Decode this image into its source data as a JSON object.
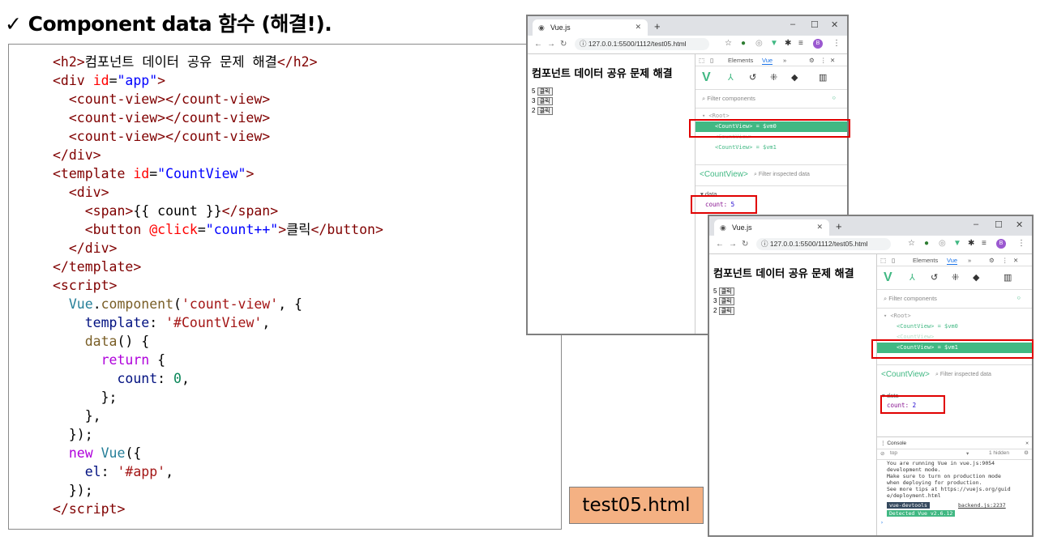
{
  "slide": {
    "title": "✓ Component data 함수 (해결!).",
    "filename_label": "test05.html"
  },
  "code": {
    "h2_text": "컴포넌트 데이터 공유 문제 해결",
    "app_id": "\"app\"",
    "template_id": "\"CountView\"",
    "span_expr": "{{ count }}",
    "click_attr": "@click",
    "click_expr": "\"count++\"",
    "button_text": "클릭",
    "component_name": "'count-view'",
    "template_ref": "'#CountView'",
    "count_init": "0",
    "el_value": "'#app'"
  },
  "browser1": {
    "tab_title": "Vue.js",
    "url": "127.0.0.1:5500/1112/test05.html",
    "heading": "컴포넌트 데이터 공유 문제 해결",
    "counts": [
      "5",
      "3",
      "2"
    ],
    "button_label": "클릭",
    "devtools_tabs": [
      "Elements",
      "Vue",
      "»"
    ],
    "filter_placeholder": "Filter components",
    "tree": [
      "▾ <Root>",
      "<CountView> = $vm0",
      "<CountView>",
      "<CountView> = $vm1"
    ],
    "inspected": "<CountView>",
    "filter_inspected": "Filter inspected data",
    "data_label": "▾ data",
    "data_key": "count:",
    "data_value": "5",
    "profile_initial": "B"
  },
  "browser2": {
    "tab_title": "Vue.js",
    "url": "127.0.0.1:5500/1112/test05.html",
    "heading": "컴포넌트 데이터 공유 문제 해결",
    "counts": [
      "5",
      "3",
      "2"
    ],
    "button_label": "클릭",
    "devtools_tabs": [
      "Elements",
      "Vue",
      "»"
    ],
    "filter_placeholder": "Filter components",
    "tree": [
      "▾ <Root>",
      "<CountView> = $vm0",
      "<CountView>",
      "<CountView> = $vm1"
    ],
    "inspected": "<CountView>",
    "filter_inspected": "Filter inspected data",
    "data_label": "▾ data",
    "data_key": "count:",
    "data_value": "2",
    "profile_initial": "B",
    "console": {
      "tab": "Console",
      "context": "top",
      "hidden": "1 hidden",
      "line1": "You are running Vue in        vue.js:9054",
      "line2": "development mode.",
      "line3": "Make sure to turn on production mode",
      "line4": "when deploying for production.",
      "line5": "See more tips at https://vuejs.org/guid",
      "line6": "e/deployment.html",
      "badge1": "vue-devtools",
      "link": "backend.js:2237",
      "badge2": "Detected Vue v2.6.12",
      "prompt": "›"
    }
  }
}
